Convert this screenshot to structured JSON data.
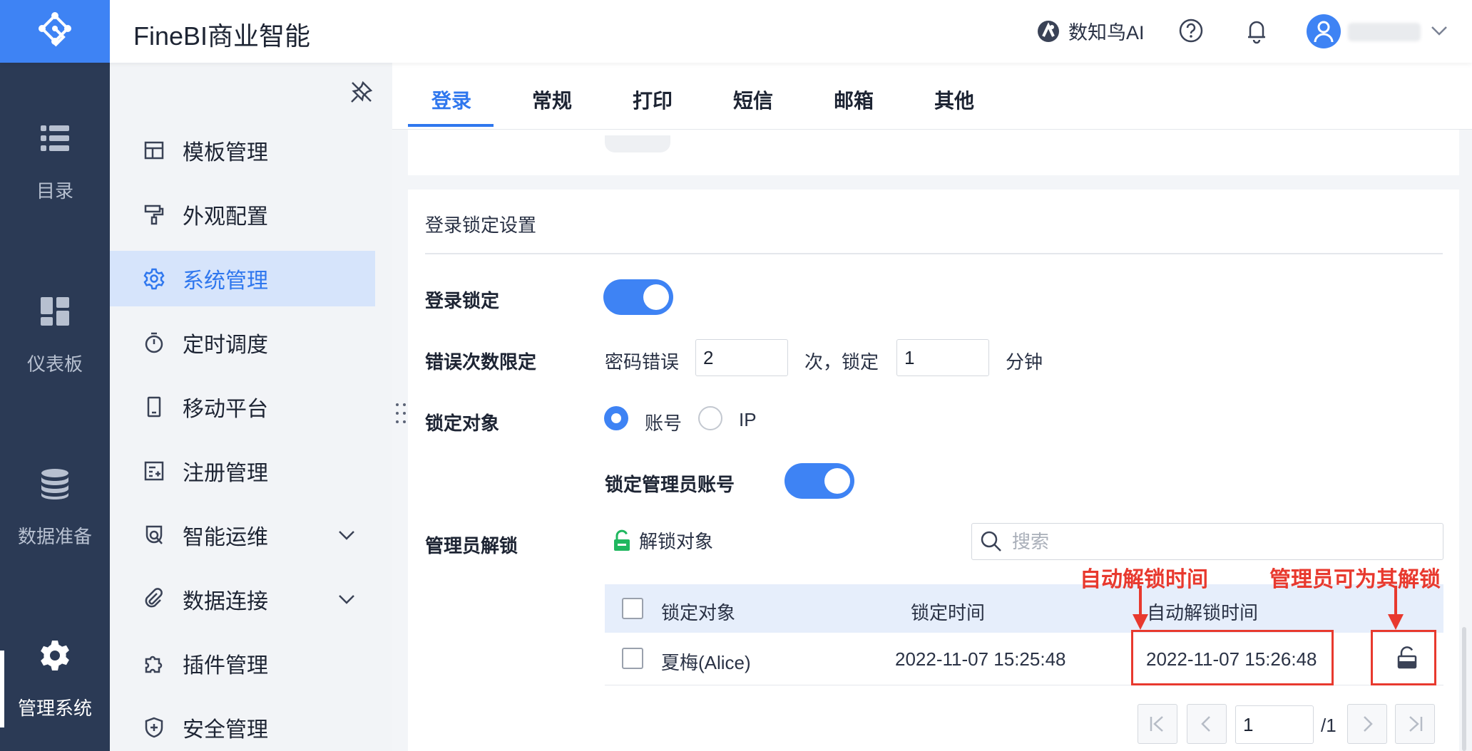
{
  "header": {
    "app_title": "FineBI商业智能",
    "ai_label": "数知鸟AI",
    "icons": [
      "logo-icon",
      "ai-bird-icon",
      "help-icon",
      "bell-icon",
      "user-avatar-icon",
      "chevron-down-icon"
    ]
  },
  "leftnav": {
    "items": [
      {
        "label": "目录",
        "icon": "list-icon"
      },
      {
        "label": "仪表板",
        "icon": "dashboard-icon"
      },
      {
        "label": "数据准备",
        "icon": "database-icon"
      },
      {
        "label": "管理系统",
        "icon": "gear-icon",
        "active": true
      }
    ]
  },
  "sidebar": {
    "items": [
      {
        "label": "模板管理",
        "icon": "template-icon"
      },
      {
        "label": "外观配置",
        "icon": "paint-roller-icon"
      },
      {
        "label": "系统管理",
        "icon": "gear-icon",
        "active": true
      },
      {
        "label": "定时调度",
        "icon": "stopwatch-icon"
      },
      {
        "label": "移动平台",
        "icon": "mobile-icon"
      },
      {
        "label": "注册管理",
        "icon": "register-icon"
      },
      {
        "label": "智能运维",
        "icon": "ops-icon",
        "expandable": true
      },
      {
        "label": "数据连接",
        "icon": "link-icon",
        "expandable": true
      },
      {
        "label": "插件管理",
        "icon": "plugin-icon"
      },
      {
        "label": "安全管理",
        "icon": "shield-icon"
      }
    ]
  },
  "tabs": [
    {
      "label": "登录",
      "active": true
    },
    {
      "label": "常规"
    },
    {
      "label": "打印"
    },
    {
      "label": "短信"
    },
    {
      "label": "邮箱"
    },
    {
      "label": "其他"
    }
  ],
  "lock_settings": {
    "section_title": "登录锁定设置",
    "login_lock": {
      "label": "登录锁定",
      "enabled": true
    },
    "error_limit": {
      "label": "错误次数限定",
      "prefix": "密码错误",
      "count": "2",
      "middle": "次，锁定",
      "minutes": "1",
      "suffix": "分钟"
    },
    "lock_target": {
      "label": "锁定对象",
      "options": [
        {
          "label": "账号",
          "selected": true
        },
        {
          "label": "IP",
          "selected": false
        }
      ]
    },
    "lock_admin": {
      "label": "锁定管理员账号",
      "enabled": true
    },
    "admin_unlock": {
      "label": "管理员解锁",
      "unlock_button": "解锁对象",
      "search_placeholder": "搜索"
    }
  },
  "table": {
    "columns": [
      "锁定对象",
      "锁定时间",
      "自动解锁时间"
    ],
    "rows": [
      {
        "target": "夏梅(Alice)",
        "lock_time": "2022-11-07 15:25:48",
        "auto_unlock_time": "2022-11-07 15:26:48"
      }
    ]
  },
  "annotations": {
    "auto_unlock": "自动解锁时间",
    "admin_can_unlock": "管理员可为其解锁",
    "color": "#e8392e"
  },
  "pager": {
    "current": "1",
    "total": "/1"
  },
  "colors": {
    "accent": "#3e83f4",
    "nav_bg": "#2b3a55",
    "active_tab": "#2f77ee",
    "unlock_green": "#1fb75f"
  }
}
